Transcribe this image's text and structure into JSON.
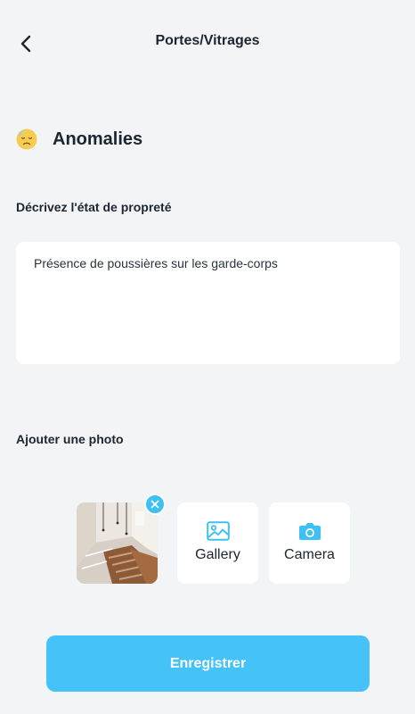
{
  "header": {
    "title": "Portes/Vitrages",
    "back_icon": "chevron-left-icon"
  },
  "section": {
    "title": "Anomalies",
    "icon": "sad-face-emoji-icon"
  },
  "description": {
    "label": "Décrivez l'état de propreté",
    "value": "Présence de poussières sur les garde-corps"
  },
  "photo": {
    "label": "Ajouter une photo",
    "gallery_label": "Gallery",
    "camera_label": "Camera",
    "gallery_icon": "image-icon",
    "camera_icon": "camera-icon",
    "remove_icon": "close-icon"
  },
  "actions": {
    "save_label": "Enregistrer"
  },
  "colors": {
    "background": "#f3f4f6",
    "accent": "#45c2f8",
    "text": "#1c2630",
    "card": "#ffffff"
  }
}
